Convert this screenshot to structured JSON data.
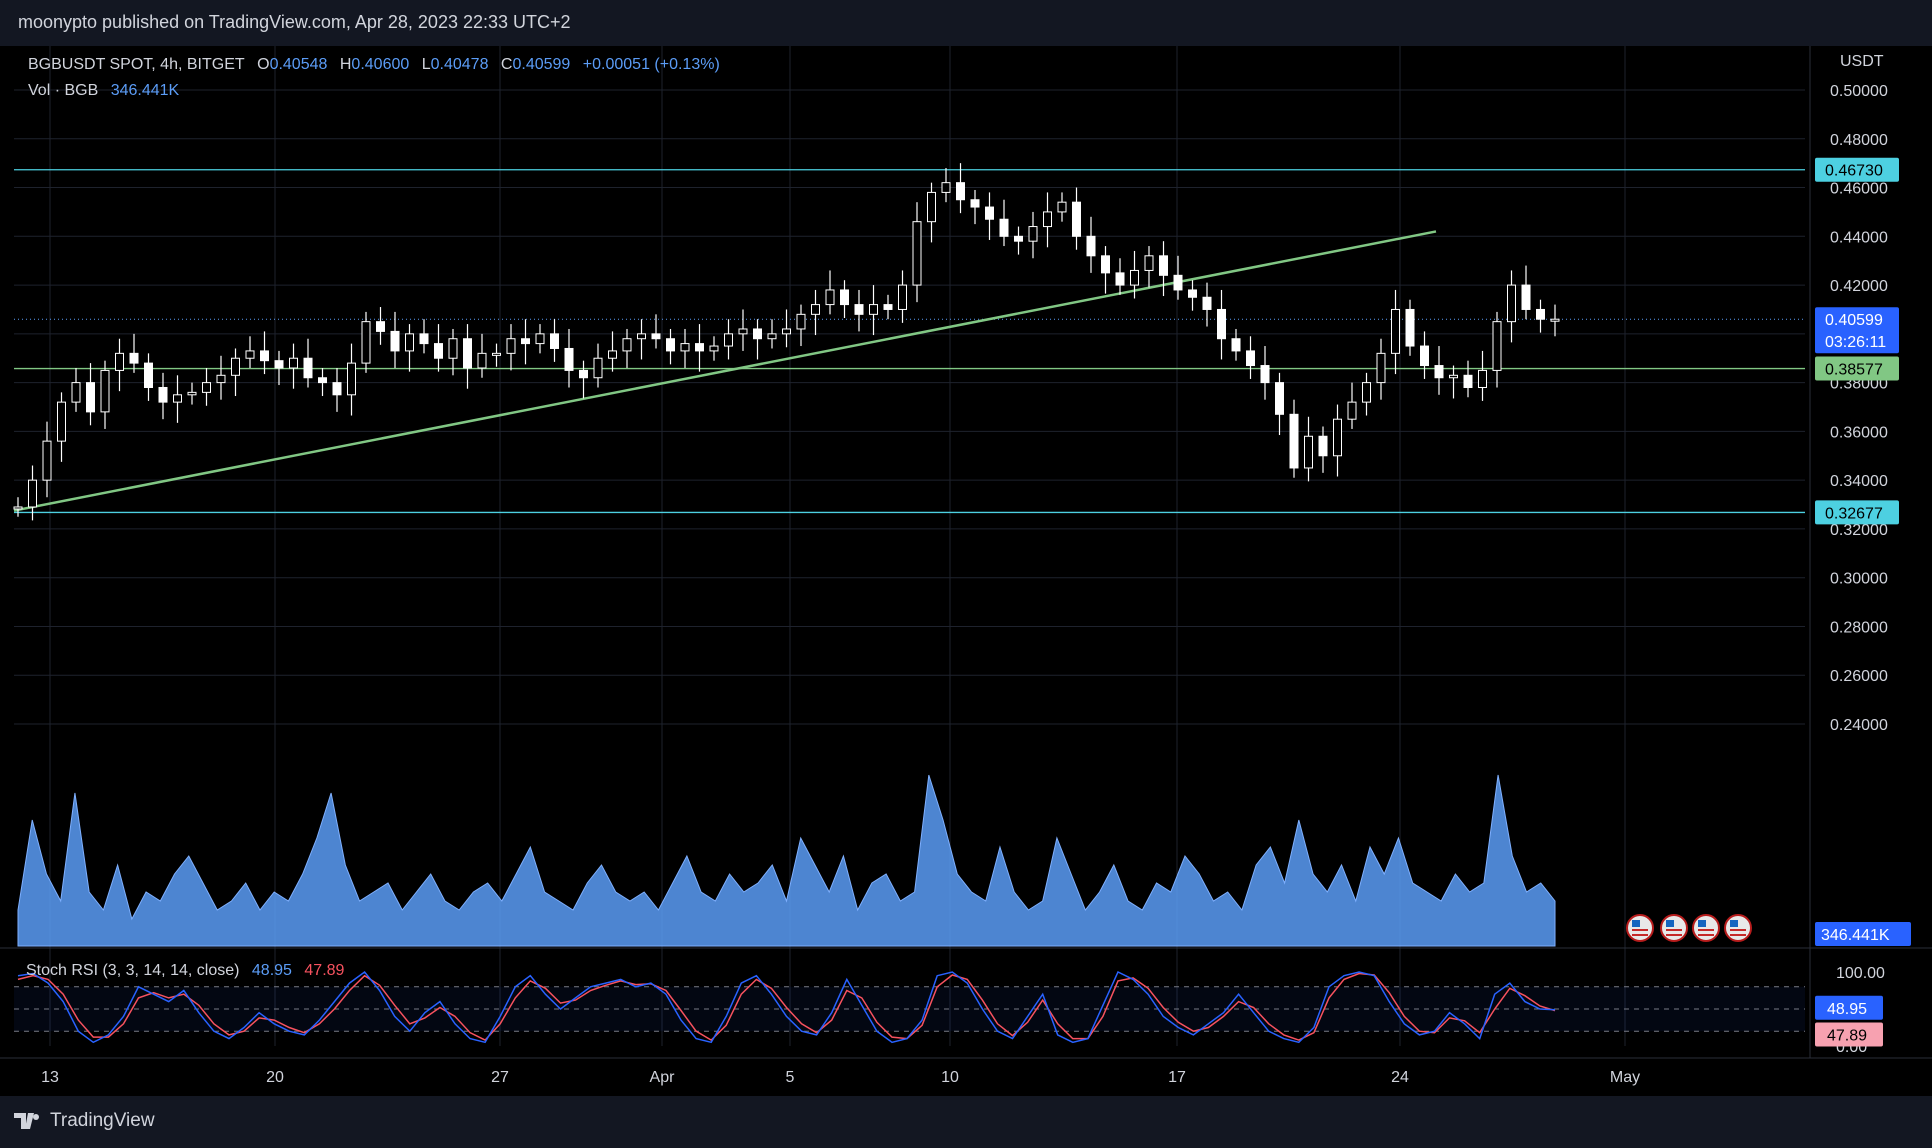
{
  "header": {
    "publisher": "moonypto published on TradingView.com, Apr 28, 2023 22:33 UTC+2"
  },
  "legend": {
    "symbol": "BGBUSDT SPOT, 4h, BITGET",
    "open_label": "O",
    "open": "0.40548",
    "high_label": "H",
    "high": "0.40600",
    "low_label": "L",
    "low": "0.40478",
    "close_label": "C",
    "close": "0.40599",
    "change": "+0.00051 (+0.13%)",
    "vol_label": "Vol · BGB",
    "vol_value": "346.441K"
  },
  "rsi_legend": {
    "label": "Stoch RSI (3, 3, 14, 14, close)",
    "k": "48.95",
    "d": "47.89"
  },
  "footer": {
    "brand": "TradingView"
  },
  "colors": {
    "background": "#000000",
    "up": "#ffffff",
    "down": "#ffffff",
    "level": "#4dd0e1",
    "trend": "#81c784",
    "volume": "#5b9cf6",
    "rsi_k": "#2962ff",
    "rsi_d": "#f7525f"
  },
  "chart_data": {
    "type": "candlestick",
    "timeframe": "4h",
    "currency": "USDT",
    "y_axis_ticks": [
      "0.50000",
      "0.48000",
      "0.46000",
      "0.44000",
      "0.42000",
      "0.40000",
      "0.38000",
      "0.36000",
      "0.34000",
      "0.32000",
      "0.30000",
      "0.28000",
      "0.26000",
      "0.24000"
    ],
    "x_axis_ticks": [
      "13",
      "20",
      "27",
      "Apr",
      "5",
      "10",
      "17",
      "24",
      "May"
    ],
    "price_labels": [
      {
        "text": "0.46730",
        "value": 0.4673,
        "style": "level"
      },
      {
        "text": "0.40599",
        "value": 0.40599,
        "style": "last",
        "sub": "03:26:11"
      },
      {
        "text": "0.38577",
        "value": 0.38577,
        "style": "trend"
      },
      {
        "text": "0.32677",
        "value": 0.32677,
        "style": "level"
      }
    ],
    "horizontal_levels": [
      0.4673,
      0.38577,
      0.32677
    ],
    "trendline": [
      {
        "date": "Mar 12",
        "price": 0.3275
      },
      {
        "date": "Apr 24",
        "price": 0.442
      }
    ],
    "price_path_hourly_start": "Mar 12",
    "price_path": [
      0.329,
      0.34,
      0.356,
      0.372,
      0.38,
      0.368,
      0.385,
      0.392,
      0.388,
      0.378,
      0.372,
      0.375,
      0.376,
      0.38,
      0.383,
      0.39,
      0.393,
      0.389,
      0.386,
      0.39,
      0.382,
      0.38,
      0.375,
      0.388,
      0.405,
      0.401,
      0.393,
      0.4,
      0.396,
      0.39,
      0.398,
      0.386,
      0.392,
      0.392,
      0.398,
      0.396,
      0.4,
      0.394,
      0.385,
      0.382,
      0.39,
      0.393,
      0.398,
      0.4,
      0.398,
      0.393,
      0.396,
      0.393,
      0.395,
      0.4,
      0.402,
      0.398,
      0.4,
      0.402,
      0.408,
      0.412,
      0.418,
      0.412,
      0.408,
      0.412,
      0.41,
      0.42,
      0.446,
      0.458,
      0.462,
      0.455,
      0.452,
      0.447,
      0.44,
      0.438,
      0.444,
      0.45,
      0.454,
      0.44,
      0.432,
      0.425,
      0.42,
      0.426,
      0.432,
      0.424,
      0.418,
      0.415,
      0.41,
      0.398,
      0.393,
      0.387,
      0.38,
      0.367,
      0.345,
      0.358,
      0.35,
      0.365,
      0.372,
      0.38,
      0.392,
      0.41,
      0.395,
      0.387,
      0.382,
      0.383,
      0.378,
      0.385,
      0.405,
      0.42,
      0.41,
      0.406,
      0.406
    ],
    "volume_peak_label": "346.441K",
    "volume": [
      20,
      70,
      40,
      25,
      85,
      30,
      20,
      45,
      15,
      30,
      25,
      40,
      50,
      35,
      20,
      25,
      35,
      20,
      30,
      25,
      40,
      60,
      85,
      45,
      25,
      30,
      35,
      20,
      30,
      40,
      25,
      20,
      30,
      35,
      25,
      40,
      55,
      30,
      25,
      20,
      35,
      45,
      30,
      25,
      30,
      20,
      35,
      50,
      30,
      25,
      40,
      30,
      35,
      45,
      25,
      60,
      45,
      30,
      50,
      20,
      35,
      40,
      25,
      30,
      95,
      70,
      40,
      30,
      25,
      55,
      30,
      20,
      25,
      60,
      40,
      20,
      30,
      45,
      25,
      20,
      35,
      30,
      50,
      40,
      25,
      30,
      20,
      45,
      55,
      35,
      70,
      40,
      30,
      45,
      25,
      55,
      40,
      60,
      35,
      30,
      25,
      40,
      30,
      35,
      95,
      50,
      30,
      35,
      25
    ],
    "stoch_rsi": {
      "name": "Stoch RSI (3, 3, 14, 14, close)",
      "ticks": [
        "100.00",
        "0.00"
      ],
      "k_last": 48.95,
      "d_last": 47.89,
      "k": [
        95,
        98,
        85,
        60,
        20,
        5,
        15,
        40,
        80,
        70,
        60,
        75,
        45,
        20,
        10,
        25,
        45,
        30,
        20,
        15,
        35,
        60,
        85,
        100,
        75,
        40,
        20,
        45,
        60,
        30,
        10,
        5,
        40,
        80,
        95,
        70,
        50,
        65,
        80,
        85,
        90,
        80,
        85,
        70,
        35,
        10,
        5,
        40,
        85,
        95,
        70,
        40,
        20,
        15,
        45,
        90,
        55,
        20,
        5,
        10,
        35,
        95,
        100,
        85,
        50,
        20,
        10,
        40,
        70,
        15,
        5,
        10,
        55,
        100,
        90,
        70,
        40,
        25,
        15,
        30,
        45,
        70,
        45,
        20,
        10,
        5,
        25,
        80,
        95,
        100,
        95,
        60,
        30,
        15,
        20,
        45,
        30,
        10,
        70,
        85,
        60,
        50,
        48.95
      ],
      "d": [
        90,
        95,
        90,
        70,
        35,
        12,
        12,
        30,
        65,
        72,
        65,
        70,
        55,
        30,
        15,
        20,
        38,
        35,
        25,
        18,
        30,
        50,
        75,
        95,
        82,
        55,
        30,
        38,
        52,
        40,
        18,
        8,
        30,
        65,
        88,
        78,
        58,
        62,
        75,
        82,
        88,
        83,
        84,
        75,
        48,
        20,
        8,
        28,
        70,
        90,
        78,
        52,
        30,
        18,
        35,
        75,
        65,
        32,
        12,
        10,
        28,
        80,
        96,
        90,
        62,
        30,
        14,
        32,
        62,
        30,
        10,
        10,
        40,
        88,
        92,
        78,
        52,
        32,
        20,
        25,
        40,
        60,
        52,
        30,
        15,
        8,
        18,
        65,
        90,
        98,
        96,
        72,
        40,
        20,
        18,
        38,
        34,
        18,
        50,
        78,
        68,
        54,
        47.89
      ]
    }
  }
}
